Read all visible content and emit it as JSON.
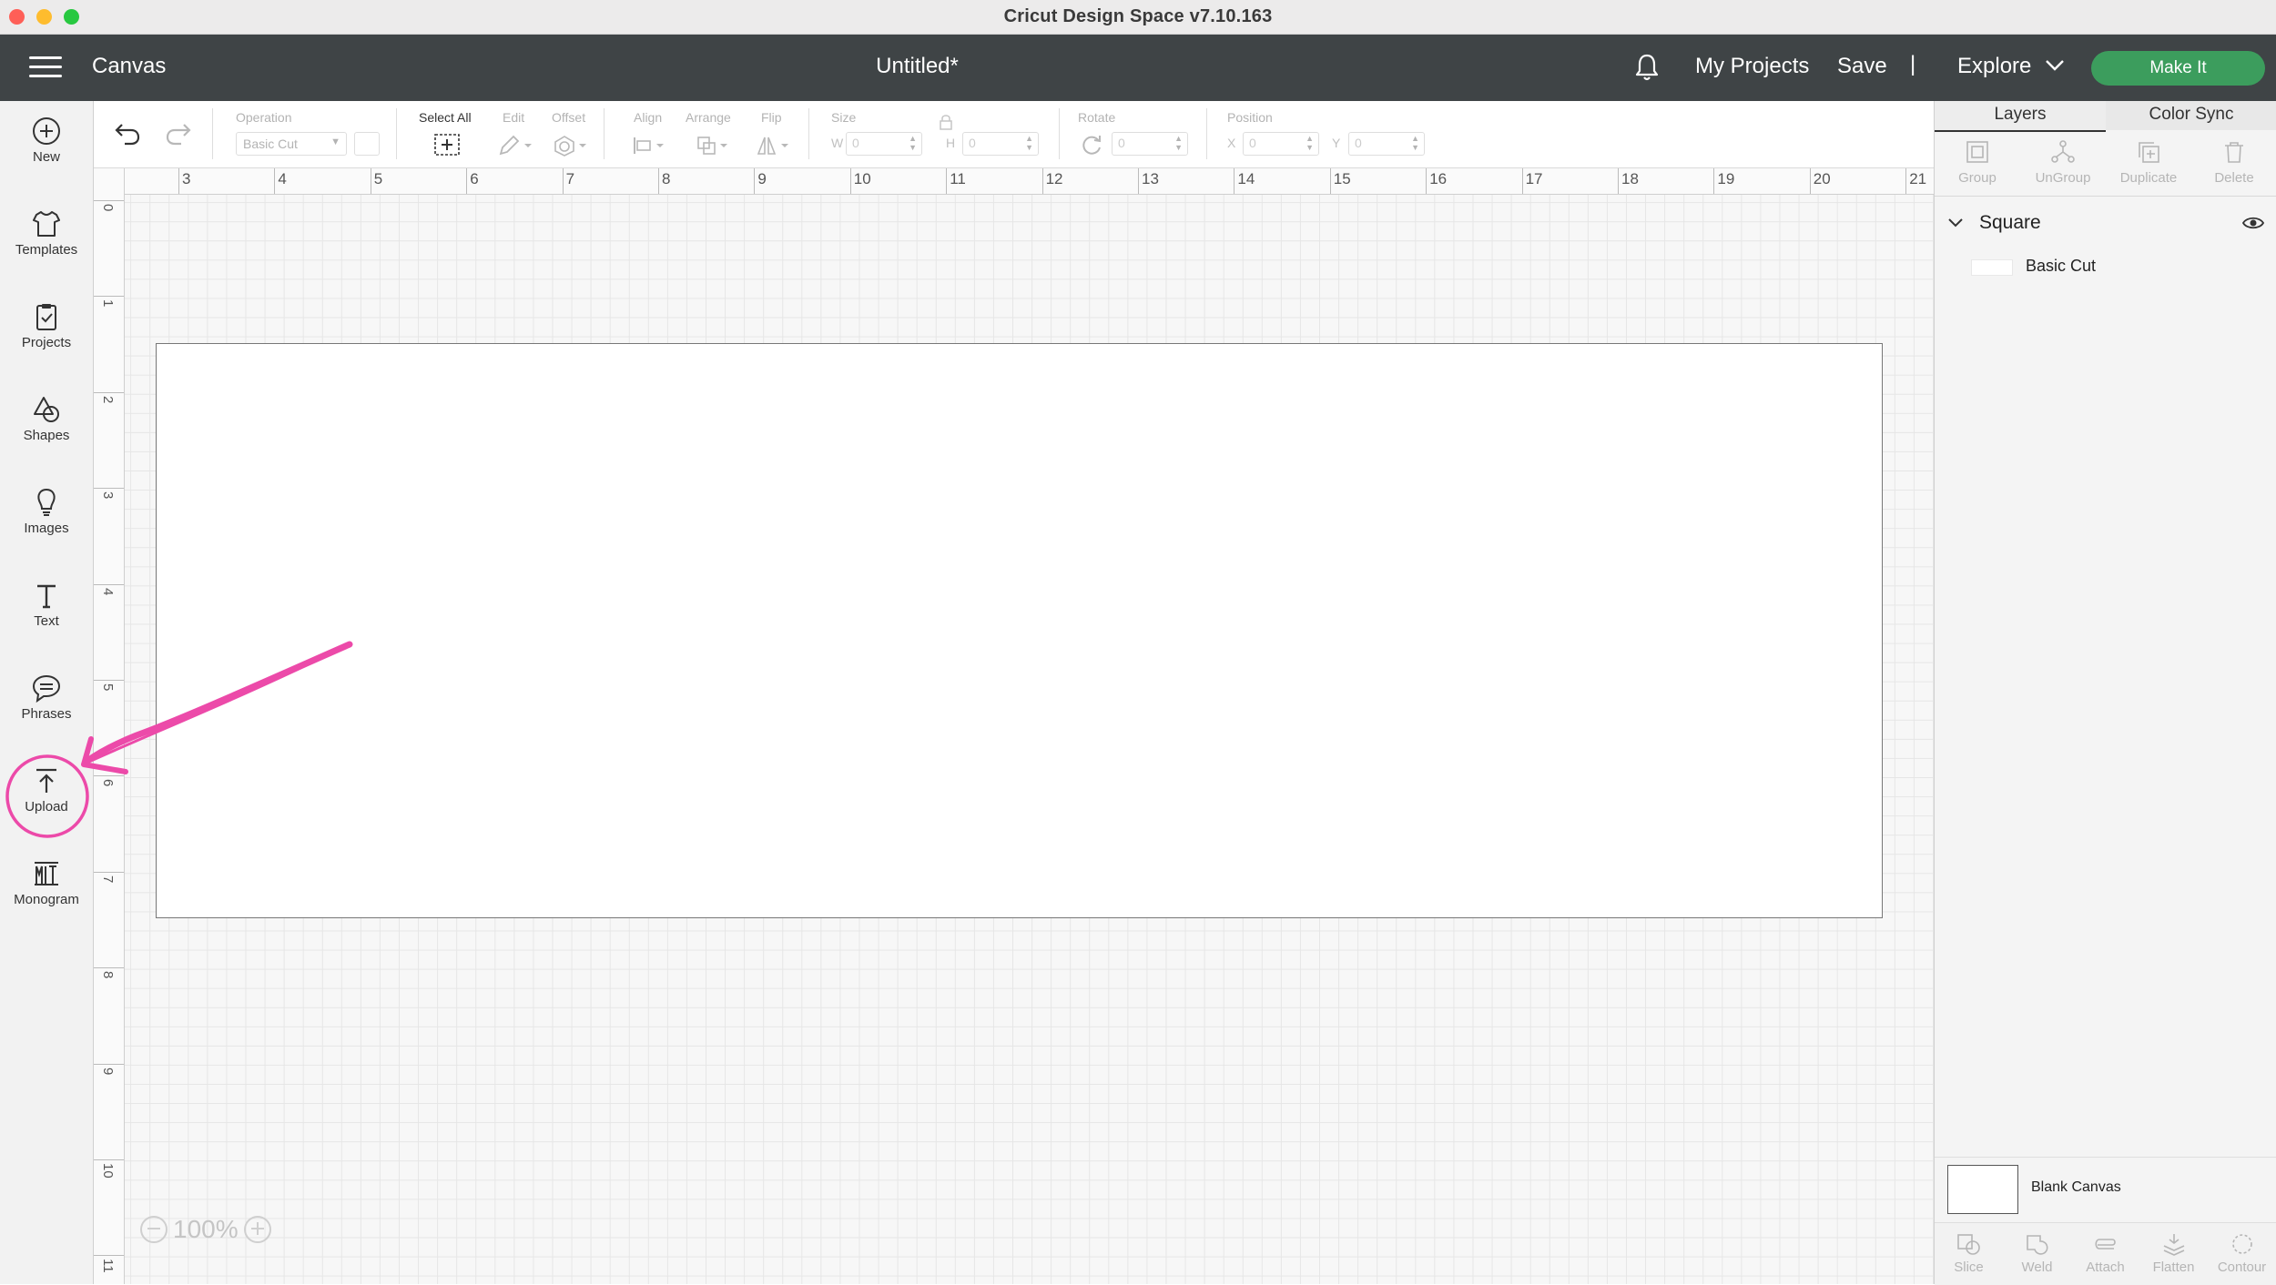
{
  "window": {
    "title": "Cricut Design Space  v7.10.163",
    "traffic_colors": [
      "#fe5f57",
      "#febc2e",
      "#28c840"
    ]
  },
  "header": {
    "section_label": "Canvas",
    "document_title": "Untitled*",
    "my_projects": "My Projects",
    "save": "Save",
    "separator": "|",
    "explore": "Explore",
    "make_it": "Make It",
    "accent_green": "#3c9d5d"
  },
  "sidebar": {
    "items": [
      {
        "label": "New",
        "icon": "plus-circle-icon"
      },
      {
        "label": "Templates",
        "icon": "shirt-icon"
      },
      {
        "label": "Projects",
        "icon": "clipboard-icon"
      },
      {
        "label": "Shapes",
        "icon": "shapes-icon"
      },
      {
        "label": "Images",
        "icon": "lightbulb-icon"
      },
      {
        "label": "Text",
        "icon": "text-t-icon"
      },
      {
        "label": "Phrases",
        "icon": "speech-bubble-icon"
      },
      {
        "label": "Upload",
        "icon": "upload-arrow-icon"
      },
      {
        "label": "Monogram",
        "icon": "monogram-icon"
      }
    ]
  },
  "toolbar": {
    "operation_label": "Operation",
    "operation_value": "Basic Cut",
    "select_all_label": "Select All",
    "edit_label": "Edit",
    "offset_label": "Offset",
    "align_label": "Align",
    "arrange_label": "Arrange",
    "flip_label": "Flip",
    "size_label": "Size",
    "w_label": "W",
    "h_label": "H",
    "w_value": "0",
    "h_value": "0",
    "rotate_label": "Rotate",
    "rotate_value": "0",
    "position_label": "Position",
    "x_label": "X",
    "y_label": "Y",
    "x_value": "0",
    "y_value": "0"
  },
  "canvas": {
    "ruler_top": [
      "3",
      "4",
      "5",
      "6",
      "7",
      "8",
      "9",
      "10",
      "11",
      "12",
      "13",
      "14",
      "15",
      "16",
      "17",
      "18",
      "19",
      "20",
      "21"
    ],
    "ruler_left": [
      "0",
      "1",
      "2",
      "3",
      "4",
      "5",
      "6",
      "7",
      "8",
      "9",
      "10",
      "11"
    ],
    "zoom_level": "100%",
    "annotation_color": "#ec4aa9"
  },
  "right_panel": {
    "tabs": [
      "Layers",
      "Color Sync"
    ],
    "layer_tools": [
      "Group",
      "UnGroup",
      "Duplicate",
      "Delete"
    ],
    "layer_group_name": "Square",
    "layer_item_name": "Basic Cut",
    "blank_canvas_label": "Blank Canvas",
    "bottom_tools": [
      "Slice",
      "Weld",
      "Attach",
      "Flatten",
      "Contour"
    ]
  }
}
